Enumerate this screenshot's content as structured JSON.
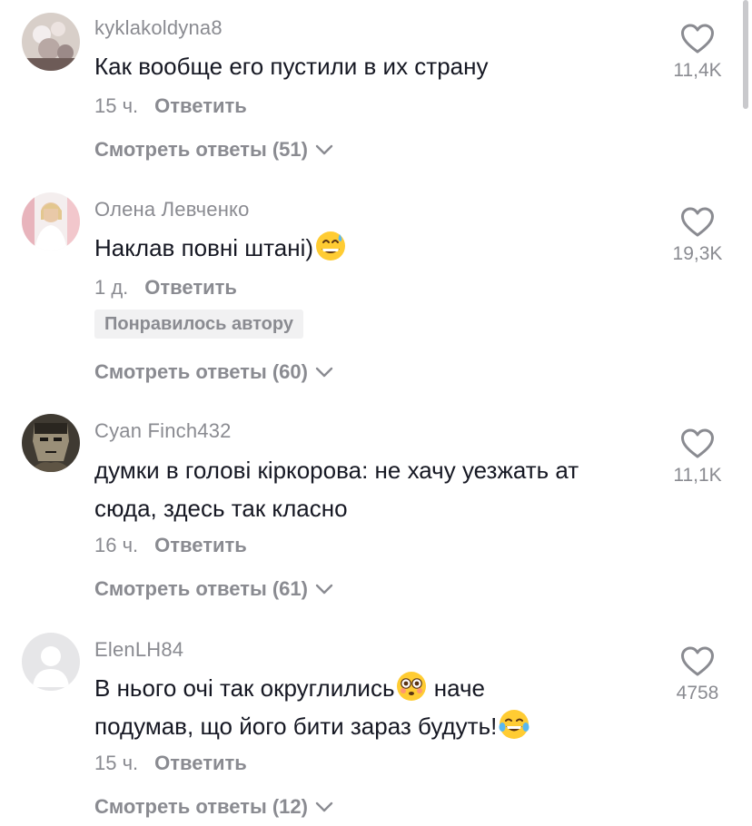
{
  "comments": [
    {
      "username": "kyklakoldyna8",
      "text": "Как вообще его пустили в их страну",
      "time": "15 ч.",
      "reply_label": "Ответить",
      "likes": "11,4K",
      "view_replies": "Смотреть ответы (51)"
    },
    {
      "username": "Олена Левченко",
      "text": "Наклав повні штані)",
      "time": "1 д.",
      "reply_label": "Ответить",
      "liked_by_author": "Понравилось автору",
      "likes": "19,3K",
      "view_replies": "Смотреть ответы (60)"
    },
    {
      "username": "Cyan Finch432",
      "text_line1": "думки в голові кіркорова: не хачу уезжать ат",
      "text_line2": "сюда, здесь так класно",
      "time": "16 ч.",
      "reply_label": "Ответить",
      "likes": "11,1K",
      "view_replies": "Смотреть ответы (61)"
    },
    {
      "username": "ElenLH84",
      "text_line1a": "В нього очі так округлились",
      "text_line1b": " наче",
      "text_line2": "подумав, що його бити зараз будуть!",
      "time": "15 ч.",
      "reply_label": "Ответить",
      "likes": "4758",
      "view_replies": "Смотреть ответы (12)"
    }
  ],
  "colors": {
    "text": "#161823",
    "muted": "#8a8b91",
    "badge_bg": "#f1f1f2"
  }
}
